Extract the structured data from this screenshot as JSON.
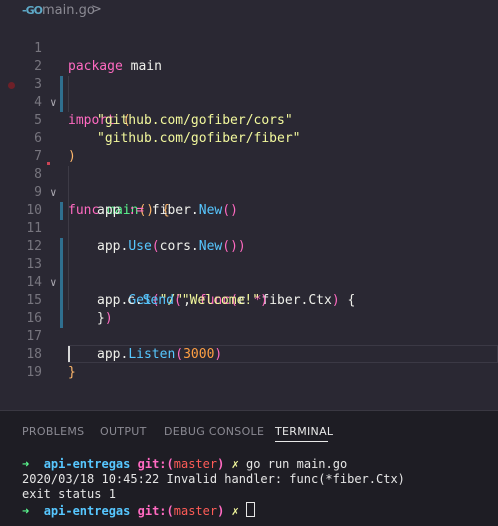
{
  "breadcrumb": {
    "file_icon": "go-file-icon",
    "file_icon_text": "-GO",
    "file": "main.go",
    "separator": ">"
  },
  "editor": {
    "line_numbers": [
      "1",
      "2",
      "3",
      "4",
      "5",
      "6",
      "7",
      "8",
      "9",
      "10",
      "11",
      "12",
      "13",
      "14",
      "15",
      "16",
      "17",
      "18",
      "19"
    ],
    "lines": {
      "l1_kw": "package",
      "l1_id": " main",
      "l3_kw": "import",
      "l3_p": " (",
      "l4": "\"github.com/gofiber/cors\"",
      "l5": "\"github.com/gofiber/fiber\"",
      "l6": ")",
      "l8_kw": "func",
      "l8_fn": " main",
      "l8_p": "()",
      "l8_b": " {",
      "l9_a": "app",
      "l9_op": " :=",
      "l9_b": " fiber.",
      "l9_m": "New",
      "l9_p": "()",
      "l11_a": "app.",
      "l11_m": "Use",
      "l11_p1": "(",
      "l11_b": "cors.",
      "l11_m2": "New",
      "l11_p2": "())",
      "l13_a": "app.",
      "l13_m": "Get",
      "l13_p1": "(",
      "l13_s": "\"/\"",
      "l13_c": ", ",
      "l13_kw": "func",
      "l13_p2": "(",
      "l13_v": "c ",
      "l13_op": "*",
      "l13_t": "fiber.Ctx",
      "l13_p3": ")",
      "l13_b": " {",
      "l14_a": "c.",
      "l14_m": "Send",
      "l14_p1": "(",
      "l14_s": "\"Welcome!\"",
      "l14_p2": ")",
      "l15_b": "}",
      "l15_p": ")",
      "l17_a": "app.",
      "l17_m": "Listen",
      "l17_p1": "(",
      "l17_n": "3000",
      "l17_p2": ")",
      "l18": "}"
    }
  },
  "panel": {
    "tabs": [
      "PROBLEMS",
      "OUTPUT",
      "DEBUG CONSOLE",
      "TERMINAL"
    ],
    "terminal": {
      "arrow": "➜",
      "dir": "api-entregas",
      "git": "git:(",
      "branch": "master",
      "git_close": ")",
      "x": "✗",
      "cmd": "go run main.go",
      "out1": "2020/03/18 10:45:22 Invalid handler: func(*fiber.Ctx)",
      "out2": "exit status 1"
    }
  },
  "colors": {
    "background": "#2a2833",
    "panel": "#1e1d24",
    "keyword": "#ff6ac1",
    "string": "#f3f99d",
    "function": "#5af78e",
    "method": "#57c7ff"
  }
}
